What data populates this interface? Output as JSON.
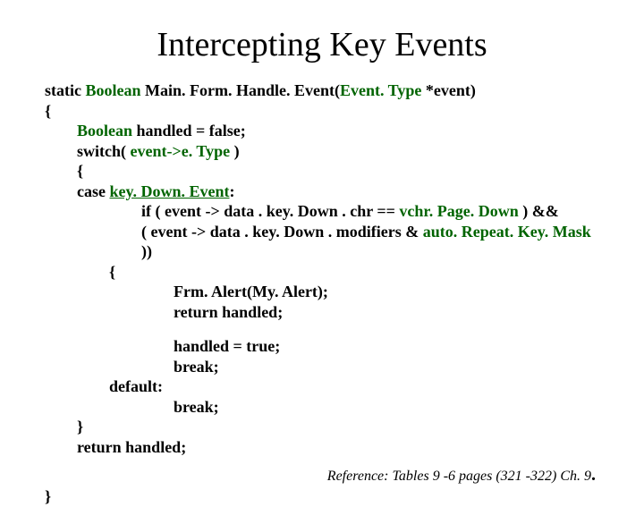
{
  "title": "Intercepting Key Events",
  "code": {
    "l1a": "static ",
    "l1b": "Boolean",
    "l1c": " Main. Form. Handle. Event(",
    "l1d": "Event. Type",
    "l1e": " *event)",
    "l2": "{",
    "l3a": "Boolean",
    "l3b": " handled = false;",
    "l4a": "switch( ",
    "l4b": "event->e. Type",
    "l4c": " )",
    "l5": "{",
    "l6a": "case ",
    "l6b": "key. Down. Event",
    "l6c": ":",
    "l7a": "if ( event -> data . key. Down . chr == ",
    "l7b": "vchr. Page. Down",
    "l7c": " ) &&",
    "l8a": " ( event -> data . key. Down . modifiers & ",
    "l8b": "auto. Repeat. Key. Mask",
    "l8c": " ))",
    "l9": "{",
    "l10": "Frm. Alert(My. Alert);",
    "l11": "return handled;",
    "l12": "handled = true;",
    "l13": "break;",
    "l14": "default:",
    "l15": "break;",
    "l16": "}",
    "l17": "return handled;",
    "l18": "}"
  },
  "reference": "Reference: Tables 9 -6 pages (321 -322) Ch. 9",
  "refdot": "."
}
